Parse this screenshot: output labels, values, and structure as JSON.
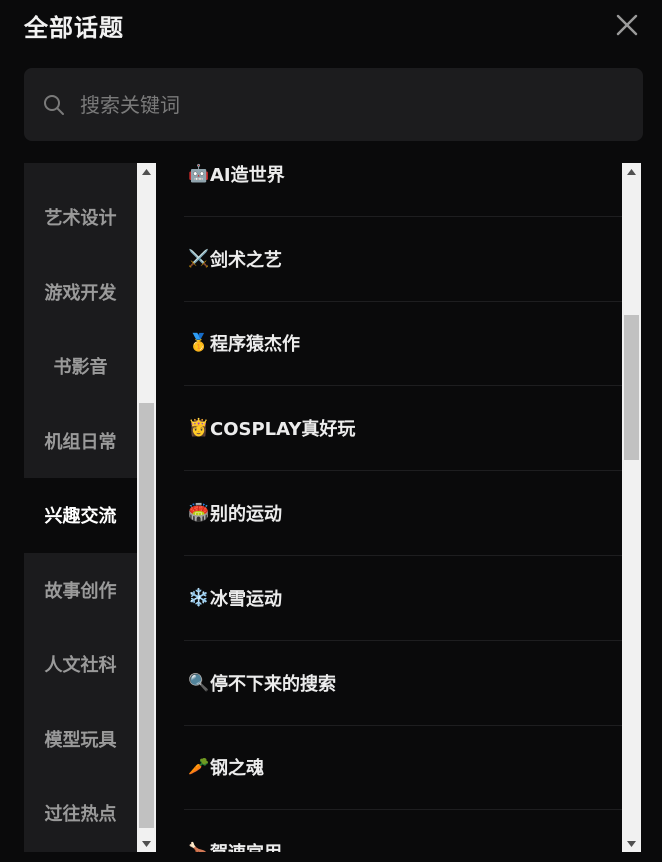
{
  "header": {
    "title": "全部话题"
  },
  "search": {
    "placeholder": "搜索关键词"
  },
  "categories": [
    {
      "label": ""
    },
    {
      "label": "艺术设计"
    },
    {
      "label": "游戏开发"
    },
    {
      "label": "书影音"
    },
    {
      "label": "机组日常"
    },
    {
      "label": "兴趣交流",
      "active": true
    },
    {
      "label": "故事创作"
    },
    {
      "label": "人文社科"
    },
    {
      "label": "模型玩具"
    },
    {
      "label": "过往热点"
    }
  ],
  "topics": [
    {
      "emoji": "🤖",
      "label": "AI造世界"
    },
    {
      "emoji": "⚔️",
      "label": "剑术之艺"
    },
    {
      "emoji": "🥇",
      "label": "程序猿杰作"
    },
    {
      "emoji": "👸",
      "label": "COSPLAY真好玩"
    },
    {
      "emoji": "🏟️",
      "label": "别的运动"
    },
    {
      "emoji": "❄️",
      "label": "冰雪运动"
    },
    {
      "emoji": "🔍",
      "label": "停不下来的搜索"
    },
    {
      "emoji": "🥕",
      "label": "钢之魂"
    },
    {
      "emoji": "🍗",
      "label": "賀速宫用"
    }
  ],
  "colors": {
    "background": "#0a0a0b",
    "panel": "#1b1b1d",
    "search_bg": "#1c1c1e"
  }
}
